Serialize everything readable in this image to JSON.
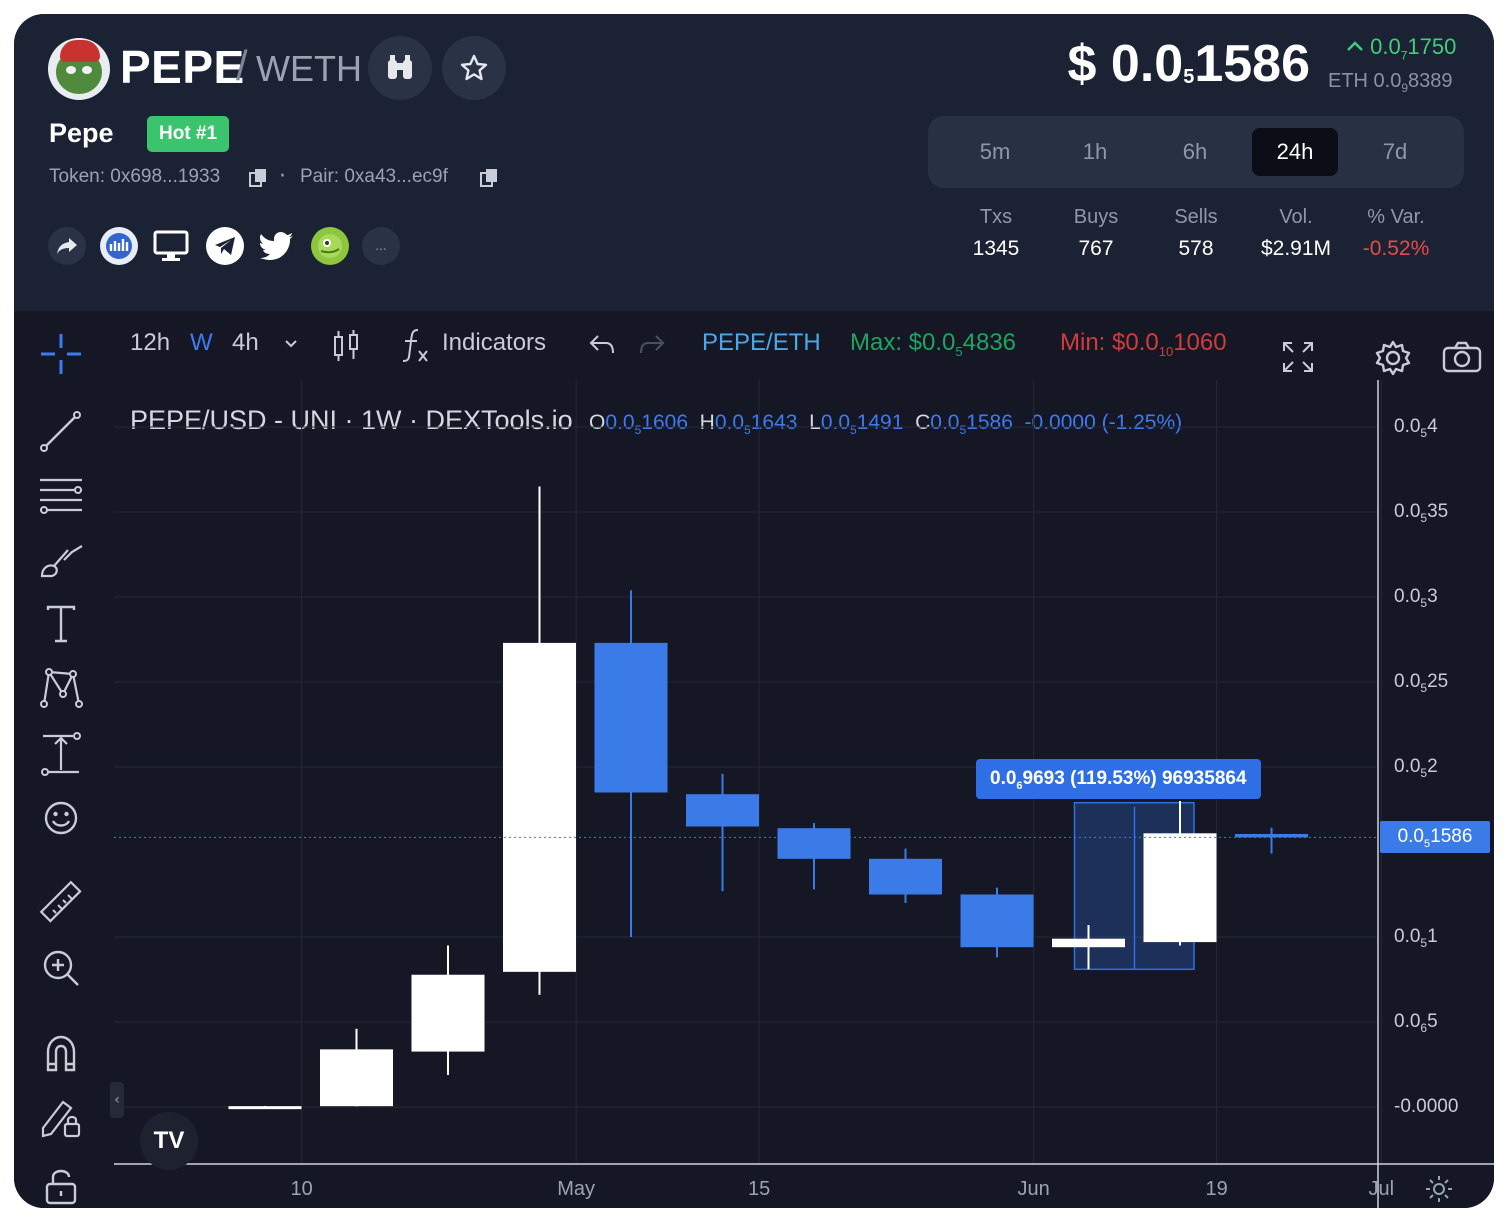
{
  "token": {
    "symbol": "PEPE",
    "slash": "/",
    "quote": "WETH",
    "name": "Pepe",
    "badge": "Hot #1",
    "token_address": "Token: 0x698...1933",
    "separator": "·",
    "pair_address": "Pair: 0xa43...ec9f"
  },
  "price": {
    "usd_prefix": "$ 0.0",
    "usd_sub": "5",
    "usd_suffix": "1586",
    "change_prefix": "0.0",
    "change_sub": "7",
    "change_suffix": "1750",
    "eth_prefix": "ETH 0.0",
    "eth_sub": "9",
    "eth_suffix": "8389"
  },
  "timeframes": {
    "items": [
      "5m",
      "1h",
      "6h",
      "24h",
      "7d"
    ],
    "selected": "24h"
  },
  "stats": {
    "txs_label": "Txs",
    "txs": "1345",
    "buys_label": "Buys",
    "buys": "767",
    "sells_label": "Sells",
    "sells": "578",
    "vol_label": "Vol.",
    "vol": "$2.91M",
    "var_label": "% Var.",
    "var": "-0.52%"
  },
  "socials": [
    "share-icon",
    "coinmarketcap-icon",
    "website-icon",
    "telegram-icon",
    "twitter-icon",
    "coingecko-icon",
    "more-icon"
  ],
  "socials_more": "...",
  "toolbar": {
    "interval_12h": "12h",
    "interval_w": "W",
    "interval_4h": "4h",
    "indicators": "Indicators",
    "pair": "PEPE/ETH",
    "max_prefix": "Max: $0.0",
    "max_sub": "5",
    "max_suffix": "4836",
    "min_prefix": "Min: $0.0",
    "min_sub": "10",
    "min_suffix": "1060"
  },
  "legend": {
    "pair": "PEPE/USD - UNI · 1W · DEXTools.io",
    "o_label": "O",
    "o_prefix": "0.0",
    "o_sub": "5",
    "o_suffix": "1606",
    "h_label": "H",
    "h_prefix": "0.0",
    "h_sub": "5",
    "h_suffix": "1643",
    "l_label": "L",
    "l_prefix": "0.0",
    "l_sub": "5",
    "l_suffix": "1491",
    "c_label": "C",
    "c_prefix": "0.0",
    "c_sub": "5",
    "c_suffix": "1586",
    "change": "-0.0000 (-1.25%)"
  },
  "measure": {
    "prefix": "0.0",
    "sub": "6",
    "suffix": "9693 (119.53%) 96935864"
  },
  "current_tag": {
    "prefix": "0.0",
    "sub": "5",
    "suffix": "1586"
  },
  "tv_logo": "TV",
  "collapse_label": "‹",
  "chart_data": {
    "type": "candlestick",
    "title": "PEPE/USD - UNI · 1W · DEXTools.io",
    "y_unit": "x 1e-5 USD",
    "y_ticks": [
      {
        "prefix": "0.0",
        "sub": "5",
        "suffix": "4",
        "value": 4e-05
      },
      {
        "prefix": "0.0",
        "sub": "5",
        "suffix": "35",
        "value": 3.5e-05
      },
      {
        "prefix": "0.0",
        "sub": "5",
        "suffix": "3",
        "value": 3e-05
      },
      {
        "prefix": "0.0",
        "sub": "5",
        "suffix": "25",
        "value": 2.5e-05
      },
      {
        "prefix": "0.0",
        "sub": "5",
        "suffix": "2",
        "value": 2e-05
      },
      {
        "prefix": "0.0",
        "sub": "5",
        "suffix": "1",
        "value": 1e-05
      },
      {
        "prefix": "0.0",
        "sub": "6",
        "suffix": "5",
        "value": 5e-06
      },
      {
        "prefix": "-0.0000",
        "sub": "",
        "suffix": "",
        "value": 0
      }
    ],
    "ylim": [
      -2e-06,
      4.25e-05
    ],
    "x_ticks": [
      {
        "label": "10",
        "week": 0.4
      },
      {
        "label": "May",
        "week": 3.4
      },
      {
        "label": "15",
        "week": 5.4
      },
      {
        "label": "Jun",
        "week": 8.4
      },
      {
        "label": "19",
        "week": 10.4
      },
      {
        "label": "Jul",
        "week": 12.2
      }
    ],
    "candles": [
      {
        "week": 0,
        "open": 3e-08,
        "high": 6e-08,
        "low": 0,
        "close": 5e-08
      },
      {
        "week": 1,
        "open": 5e-08,
        "high": 4.6e-06,
        "low": 4e-08,
        "close": 3.39e-06
      },
      {
        "week": 2,
        "open": 3.26e-06,
        "high": 9.5e-06,
        "low": 1.88e-06,
        "close": 7.78e-06
      },
      {
        "week": 3,
        "open": 7.95e-06,
        "high": 3.65e-05,
        "low": 6.6e-06,
        "close": 2.73e-05
      },
      {
        "week": 4,
        "open": 2.73e-05,
        "high": 3.04e-05,
        "low": 1e-05,
        "close": 1.85e-05
      },
      {
        "week": 5,
        "open": 1.84e-05,
        "high": 1.96e-05,
        "low": 1.27e-05,
        "close": 1.65e-05
      },
      {
        "week": 6,
        "open": 1.64e-05,
        "high": 1.67e-05,
        "low": 1.28e-05,
        "close": 1.46e-05
      },
      {
        "week": 7,
        "open": 1.46e-05,
        "high": 1.52e-05,
        "low": 1.2e-05,
        "close": 1.25e-05
      },
      {
        "week": 8,
        "open": 1.25e-05,
        "high": 1.29e-05,
        "low": 8.8e-06,
        "close": 9.4e-06
      },
      {
        "week": 9,
        "open": 9.4e-06,
        "high": 1.07e-05,
        "low": 8.1e-06,
        "close": 9.9e-06
      },
      {
        "week": 10,
        "open": 9.7e-06,
        "high": 1.8e-05,
        "low": 9.5e-06,
        "close": 1.61e-05
      },
      {
        "week": 11,
        "open": 1.606e-05,
        "high": 1.643e-05,
        "low": 1.491e-05,
        "close": 1.586e-05
      }
    ],
    "current_price": 1.586e-05,
    "measure_range": {
      "from_week": 9,
      "to_week": 10,
      "low": 8.1e-06,
      "high": 1.79e-05
    },
    "grid": true
  },
  "colors": {
    "up": "#ffffff",
    "down": "#3b7be8",
    "grid": "#232838",
    "positive": "#3fcf7a",
    "negative": "#e44b4b",
    "accent": "#3d7bf2"
  }
}
